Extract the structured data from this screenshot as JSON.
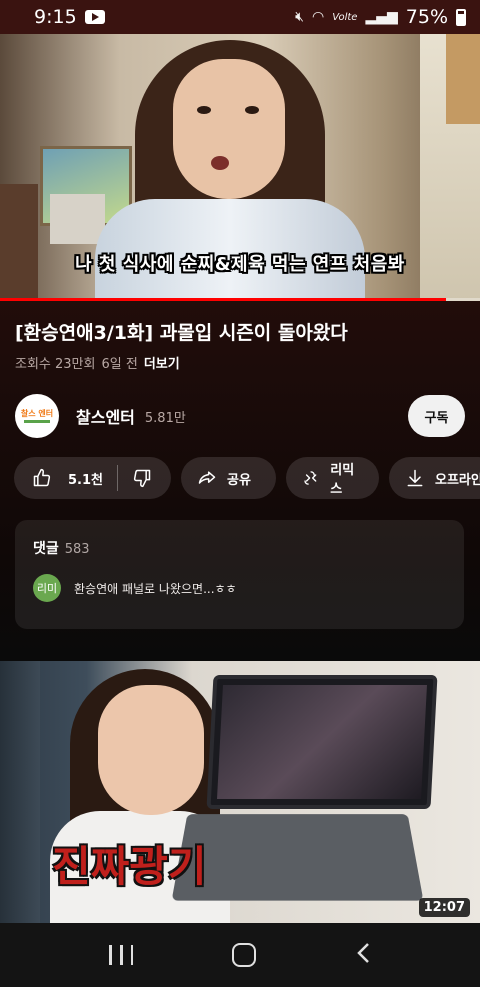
{
  "status_bar": {
    "time": "9:15",
    "network_label": "Volte",
    "battery": "75%"
  },
  "player": {
    "subtitle": "나 첫 식사에 순찌&제육 먹는 연프 처음봐",
    "progress": 0.93
  },
  "video": {
    "title": "[환승연애3/1화] 과몰입 시즌이 돌아왔다",
    "views": "조회수 23만회",
    "age": "6일 전",
    "more_label": "더보기"
  },
  "channel": {
    "avatar_text": "찰스 엔터",
    "name": "찰스엔터",
    "subscribers": "5.81만",
    "subscribe_label": "구독"
  },
  "actions": {
    "like_count": "5.1천",
    "share_label": "공유",
    "remix_label": "리믹스",
    "offline_label": "오프라인"
  },
  "comments": {
    "label": "댓글",
    "count": "583",
    "top_comment": {
      "avatar_text": "리미",
      "text": "환승연애 패널로 나왔으면...ㅎㅎ"
    }
  },
  "next_video": {
    "caption": "진짜광기",
    "duration": "12:07"
  }
}
